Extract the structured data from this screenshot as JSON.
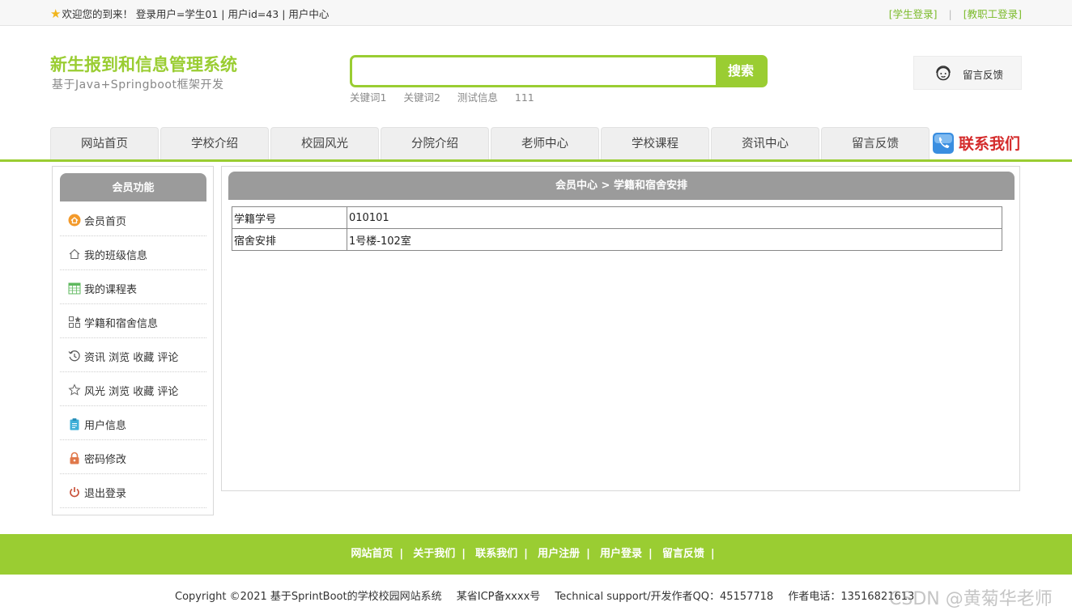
{
  "topbar": {
    "welcome": "欢迎您的到来！ 登录用户=学生01 | 用户id=43 | 用户中心",
    "student_login": "[学生登录]",
    "staff_login": "[教职工登录]"
  },
  "brand": {
    "title": "新生报到和信息管理系统",
    "subtitle": "基于Java+Springboot框架开发"
  },
  "search": {
    "value": "",
    "button": "搜索",
    "hotwords": [
      "关键词1",
      "关键词2",
      "测试信息",
      "111"
    ]
  },
  "feedback_box": {
    "label": "留言反馈"
  },
  "nav": {
    "tabs": [
      "网站首页",
      "学校介绍",
      "校园风光",
      "分院介绍",
      "老师中心",
      "学校课程",
      "资讯中心",
      "留言反馈"
    ],
    "contact": "联系我们"
  },
  "sidebar": {
    "title": "会员功能",
    "items": [
      {
        "label": "会员首页",
        "icon": "home-circle-icon"
      },
      {
        "label": "我的班级信息",
        "icon": "house-icon"
      },
      {
        "label": "我的课程表",
        "icon": "calendar-icon"
      },
      {
        "label": "学籍和宿舍信息",
        "icon": "grid-icon"
      },
      {
        "label": "资讯 浏览 收藏 评论",
        "icon": "history-icon"
      },
      {
        "label": "风光 浏览 收藏 评论",
        "icon": "star-icon"
      },
      {
        "label": "用户信息",
        "icon": "clipboard-icon"
      },
      {
        "label": "密码修改",
        "icon": "lock-icon"
      },
      {
        "label": "退出登录",
        "icon": "power-icon"
      }
    ]
  },
  "main": {
    "heading": "会员中心 > 学籍和宿舍安排",
    "rows": [
      {
        "key": "学籍学号",
        "value": "010101"
      },
      {
        "key": "宿舍安排",
        "value": "1号楼-102室"
      }
    ]
  },
  "footer": {
    "links": [
      "网站首页",
      "关于我们",
      "联系我们",
      "用户注册",
      "用户登录",
      "留言反馈"
    ],
    "copyright": "Copyright ©2021 基于SprintBoot的学校校园网站系统",
    "icp": "某省ICP备xxxx号",
    "support": "Technical support/开发作者QQ：45157718",
    "phone": "作者电话：13516821613"
  },
  "watermark": "CSDN @黄菊华老师",
  "colors": {
    "accent": "#9acd32",
    "panel_header": "#9b9b9b",
    "contact": "#d42b2b"
  }
}
